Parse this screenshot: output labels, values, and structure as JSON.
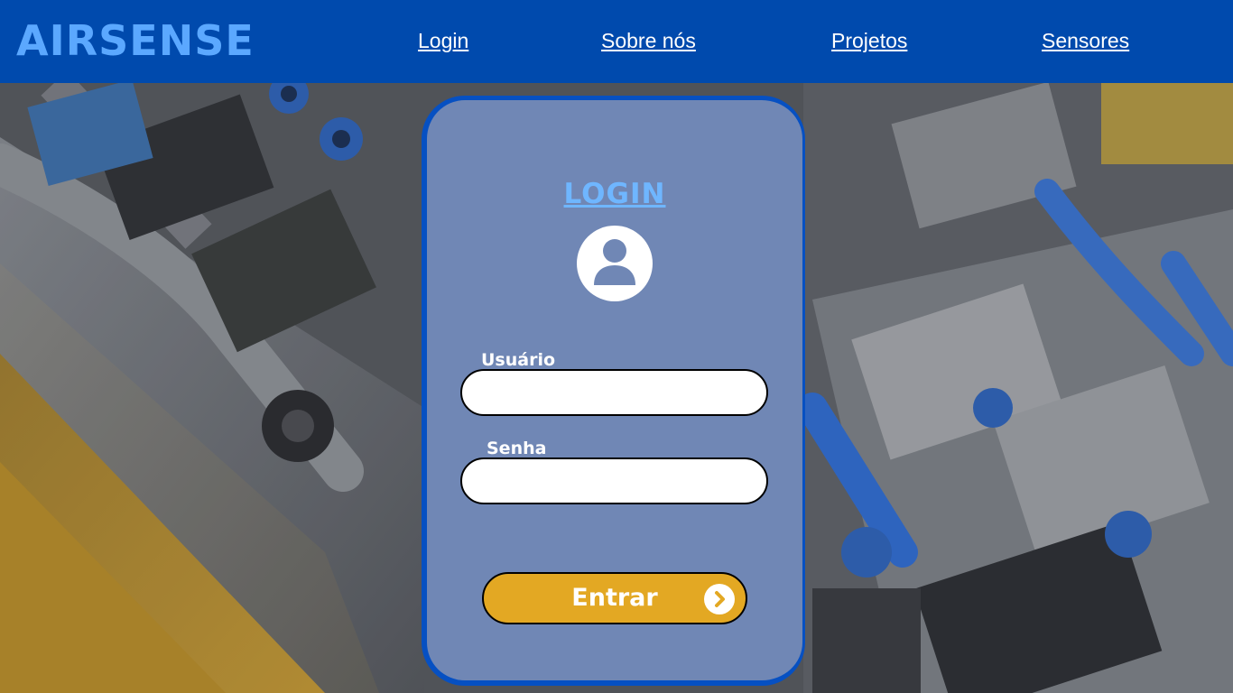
{
  "header": {
    "logo": "AIRSENSE",
    "nav": {
      "login": "Login",
      "about": "Sobre nós",
      "projects": "Projetos",
      "sensors": "Sensores"
    }
  },
  "login_card": {
    "title": "LOGIN",
    "user_label": "Usuário",
    "user_value": "",
    "password_label": "Senha",
    "password_value": "",
    "submit_label": "Entrar"
  },
  "icons": {
    "avatar": "user-circle-icon",
    "submit_arrow": "chevron-right-circle-icon"
  },
  "colors": {
    "header_bg": "#004aad",
    "logo": "#5ba8ff",
    "card_bg": "#7087b5",
    "card_border": "#0650c2",
    "card_title": "#6fb6ff",
    "button_bg": "#e3a823"
  }
}
